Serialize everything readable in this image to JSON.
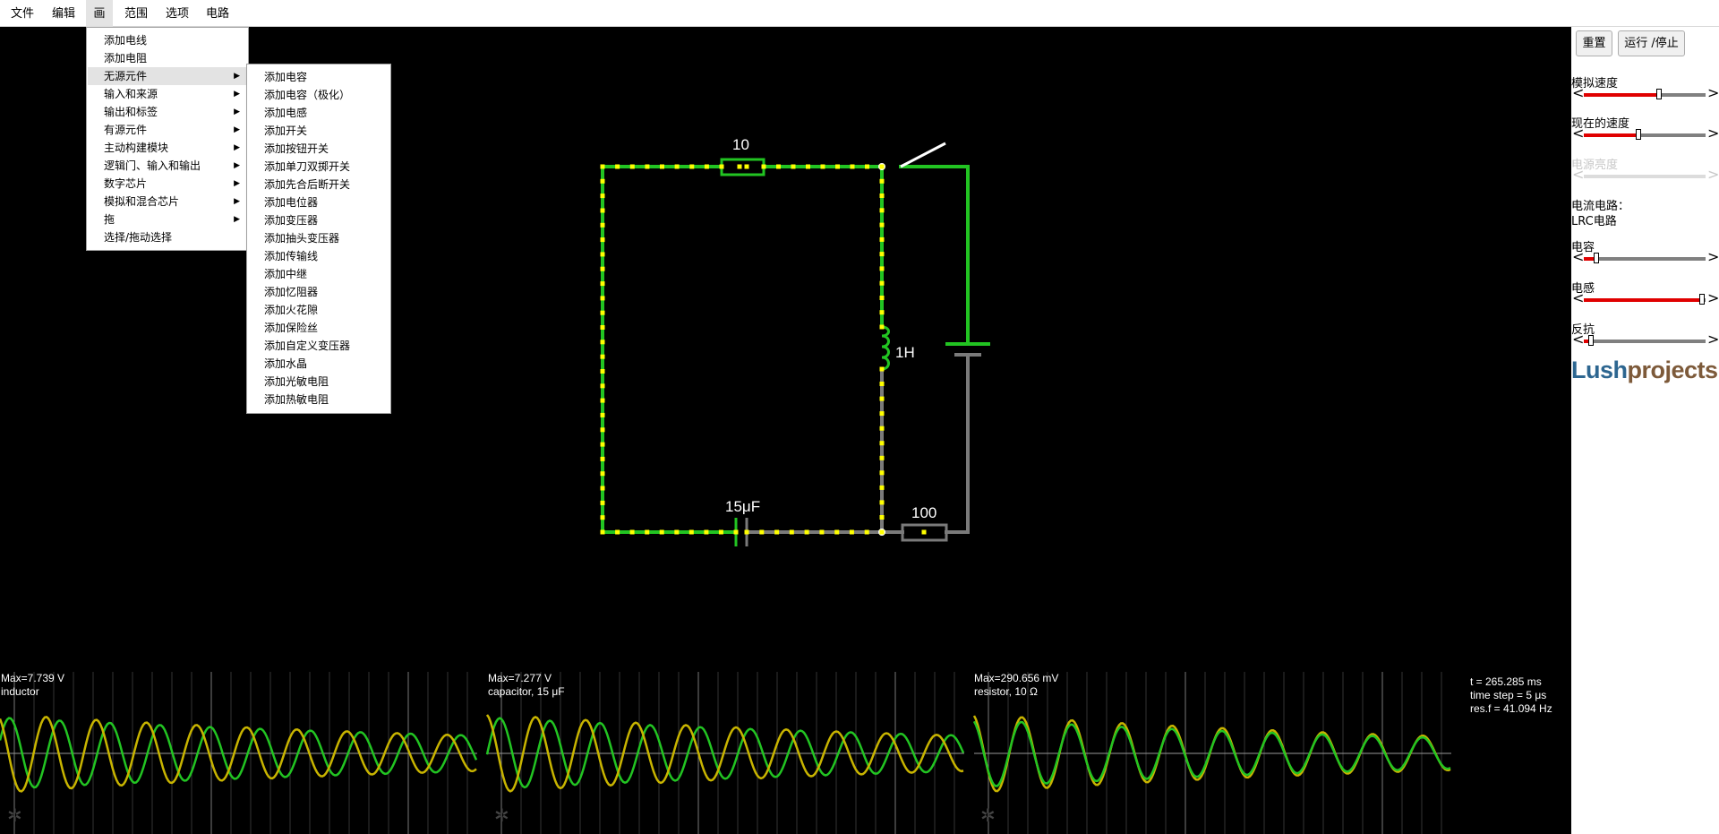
{
  "menubar": {
    "items": [
      "文件",
      "编辑",
      "画",
      "范围",
      "选项",
      "电路"
    ]
  },
  "draw_menu": {
    "items": [
      {
        "label": "添加电线",
        "submenu": false
      },
      {
        "label": "添加电阻",
        "submenu": false
      },
      {
        "label": "无源元件",
        "submenu": true
      },
      {
        "label": "输入和来源",
        "submenu": true
      },
      {
        "label": "输出和标签",
        "submenu": true
      },
      {
        "label": "有源元件",
        "submenu": true
      },
      {
        "label": "主动构建模块",
        "submenu": true
      },
      {
        "label": "逻辑门、输入和输出",
        "submenu": true
      },
      {
        "label": "数字芯片",
        "submenu": true
      },
      {
        "label": "模拟和混合芯片",
        "submenu": true
      },
      {
        "label": "拖",
        "submenu": true
      },
      {
        "label": "选择/拖动选择",
        "submenu": false
      }
    ]
  },
  "passive_menu": {
    "items": [
      "添加电容",
      "添加电容（极化）",
      "添加电感",
      "添加开关",
      "添加按钮开关",
      "添加单刀双掷开关",
      "添加先合后断开关",
      "添加电位器",
      "添加变压器",
      "添加抽头变压器",
      "添加传输线",
      "添加中继",
      "添加忆阻器",
      "添加火花隙",
      "添加保险丝",
      "添加自定义变压器",
      "添加水晶",
      "添加光敏电阻",
      "添加热敏电阻"
    ]
  },
  "circuit": {
    "resistor_top_label": "10",
    "inductor_label": "1H",
    "capacitor_label": "15μF",
    "resistor_bottom_label": "100"
  },
  "sidebar": {
    "reset_label": "重置",
    "run_stop_label": "运行 /停止",
    "sim_speed_label": "模拟速度",
    "current_speed_label": "现在的速度",
    "power_brightness_label": "电源亮度",
    "circuit_heading": "电流电路：",
    "circuit_name": "LRC电路",
    "capacitance_label": "电容",
    "inductance_label": "电感",
    "resistance_label": "反抗",
    "arrow_left": "<",
    "arrow_right": ">",
    "logo_part1": "Lush",
    "logo_part2": "projects",
    "sliders": {
      "sim_speed": 0.62,
      "current_speed": 0.45,
      "power_brightness": 0.0,
      "capacitance": 0.1,
      "inductance": 0.97,
      "resistance": 0.06
    }
  },
  "scopes": [
    {
      "max": "Max=7.739 V",
      "name": "inductor"
    },
    {
      "max": "Max=7.277 V",
      "name": "capacitor, 15 μF"
    },
    {
      "max": "Max=290.656 mV",
      "name": "resistor, 10 Ω"
    }
  ],
  "scope_info": {
    "time": "t = 265.285 ms",
    "time_step": "time step = 5 μs",
    "res_freq": "res.f = 41.094 Hz"
  },
  "colors": {
    "wire_green": "#22c422",
    "wire_gray": "#7a7a7a",
    "current_dot": "#ffff00",
    "trace_green": "#22c422",
    "trace_yellow": "#c8b400",
    "slider_red": "#e00000"
  }
}
